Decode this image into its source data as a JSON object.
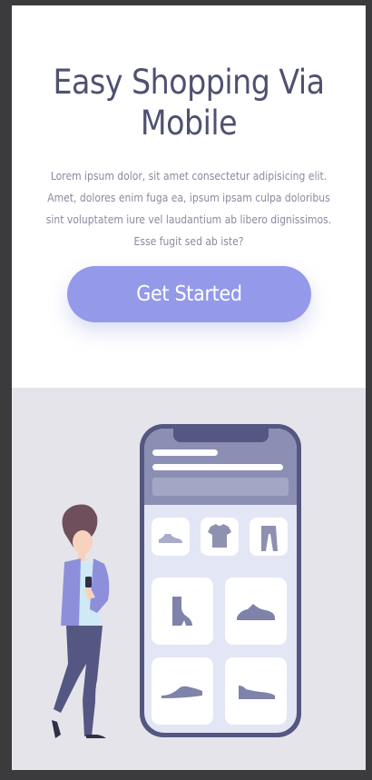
{
  "hero": {
    "title": "Easy Shopping Via Mobile",
    "body": "Lorem ipsum dolor, sit amet consectetur adipisicing elit. Amet, dolores enim fuga ea, ipsum ipsam culpa doloribus sint voluptatem iure vel laudantium ab libero dignissimos. Esse fugit sed ab iste?",
    "cta_label": "Get Started"
  },
  "illustration": {
    "icons": [
      "shoe-icon",
      "tshirt-icon",
      "trousers-icon",
      "boot-icon",
      "sneaker-icon",
      "flat-shoe-icon",
      "sneaker-icon"
    ]
  },
  "colors": {
    "accent": "#9499ea",
    "heading": "#4f5170",
    "text": "#8a8aa0",
    "illustration_bg": "#e5e4ea",
    "phone": "#545781"
  }
}
